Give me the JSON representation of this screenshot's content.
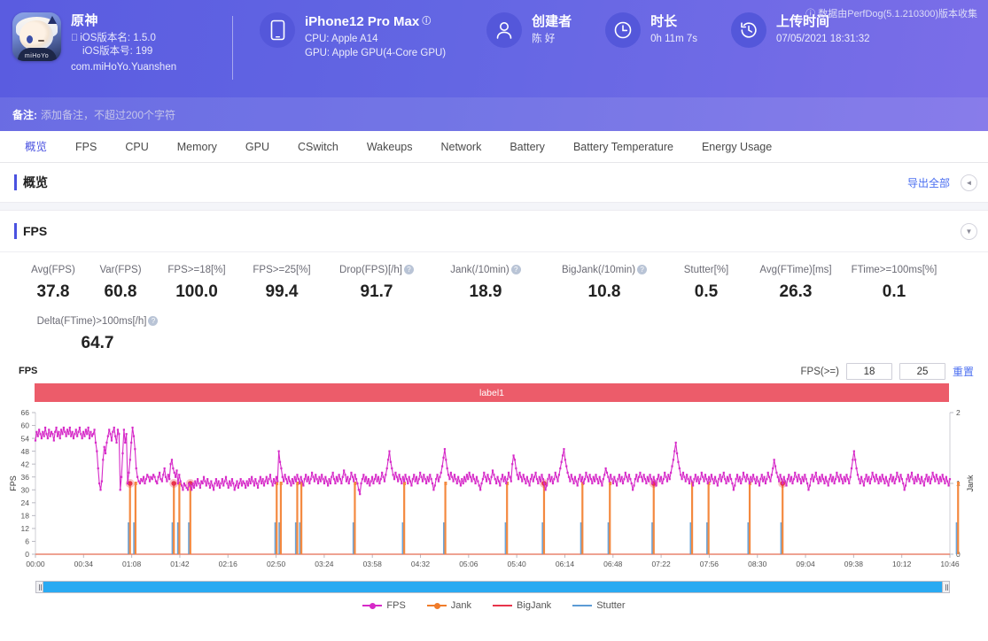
{
  "header": {
    "app": {
      "name": "原神",
      "icon_brand": "miHoYo",
      "version_name_label": "iOS版本名: 1.5.0",
      "version_code_label": "iOS版本号: 199",
      "package": "com.miHoYo.Yuanshen",
      "apple_glyph": ""
    },
    "device": {
      "title": "iPhone12 Pro Max",
      "info_glyph": "i",
      "cpu": "CPU: Apple A14",
      "gpu": "GPU: Apple GPU(4-Core GPU)"
    },
    "creator": {
      "title": "创建者",
      "value": "陈 好"
    },
    "duration": {
      "title": "时长",
      "value": "0h 11m 7s"
    },
    "upload": {
      "title": "上传时间",
      "value": "07/05/2021 18:31:32"
    },
    "collect_note": "数据由PerfDog(5.1.210300)版本收集",
    "note": {
      "label": "备注:",
      "placeholder": "添加备注，不超过200个字符"
    }
  },
  "tabs": [
    {
      "label": "概览",
      "active": true
    },
    {
      "label": "FPS",
      "active": false
    },
    {
      "label": "CPU",
      "active": false
    },
    {
      "label": "Memory",
      "active": false
    },
    {
      "label": "GPU",
      "active": false
    },
    {
      "label": "CSwitch",
      "active": false
    },
    {
      "label": "Wakeups",
      "active": false
    },
    {
      "label": "Network",
      "active": false
    },
    {
      "label": "Battery",
      "active": false
    },
    {
      "label": "Battery Temperature",
      "active": false
    },
    {
      "label": "Energy Usage",
      "active": false
    }
  ],
  "overview_section": {
    "title": "概览",
    "export_all": "导出全部",
    "collapse_icon": "◄"
  },
  "fps_section": {
    "title": "FPS",
    "collapse_icon": "▼"
  },
  "metrics": [
    {
      "label": "Avg(FPS)",
      "value": "37.8",
      "help": false
    },
    {
      "label": "Var(FPS)",
      "value": "60.8",
      "help": false
    },
    {
      "label": "FPS>=18[%]",
      "value": "100.0",
      "help": false
    },
    {
      "label": "FPS>=25[%]",
      "value": "99.4",
      "help": false
    },
    {
      "label": "Drop(FPS)[/h]",
      "value": "91.7",
      "help": true
    },
    {
      "label": "Jank(/10min)",
      "value": "18.9",
      "help": true
    },
    {
      "label": "BigJank(/10min)",
      "value": "10.8",
      "help": true
    },
    {
      "label": "Stutter[%]",
      "value": "0.5",
      "help": false
    },
    {
      "label": "Avg(FTime)[ms]",
      "value": "26.3",
      "help": false
    },
    {
      "label": "FTime>=100ms[%]",
      "value": "0.1",
      "help": false
    }
  ],
  "metrics_row2": [
    {
      "label": "Delta(FTime)>100ms[/h]",
      "value": "64.7",
      "help": true
    }
  ],
  "chart_controls": {
    "corner_label": "FPS",
    "threshold_label": "FPS(>=)",
    "threshold_low": "18",
    "threshold_high": "25",
    "reset_label": "重置"
  },
  "chart_data": {
    "type": "line",
    "title": "FPS",
    "band_label": "label1",
    "band_color": "#ec5c6a",
    "xlabel": "",
    "ylabel": "FPS",
    "y2label": "Jank",
    "ylim": [
      0,
      66
    ],
    "y2lim": [
      0,
      2
    ],
    "yticks": [
      0,
      6,
      12,
      18,
      24,
      30,
      36,
      42,
      48,
      54,
      60,
      66
    ],
    "y2ticks": [
      0,
      1,
      2
    ],
    "xticks": [
      "00:00",
      "00:34",
      "01:08",
      "01:42",
      "02:16",
      "02:50",
      "03:24",
      "03:58",
      "04:32",
      "05:06",
      "05:40",
      "06:14",
      "06:48",
      "07:22",
      "07:56",
      "08:30",
      "09:04",
      "09:38",
      "10:12",
      "10:46"
    ],
    "grid": false,
    "legend_position": "bottom",
    "legend": [
      {
        "name": "FPS",
        "color": "#d62ac8",
        "marker": "dot"
      },
      {
        "name": "Jank",
        "color": "#f07c2a",
        "marker": "dot"
      },
      {
        "name": "BigJank",
        "color": "#e8344a",
        "marker": "line"
      },
      {
        "name": "Stutter",
        "color": "#5b9bd5",
        "marker": "line"
      }
    ],
    "series": [
      {
        "name": "FPS",
        "color": "#d62ac8",
        "axis": "left",
        "values": [
          53,
          57,
          55,
          58,
          56,
          54,
          57,
          55,
          59,
          56,
          54,
          58,
          55,
          57,
          56,
          53,
          57,
          59,
          55,
          57,
          54,
          58,
          56,
          59,
          57,
          55,
          58,
          56,
          59,
          55,
          57,
          54,
          56,
          58,
          55,
          57,
          59,
          56,
          54,
          57,
          55,
          58,
          56,
          59,
          54,
          57,
          55,
          56,
          58,
          52,
          48,
          40,
          33,
          30,
          34,
          44,
          50,
          47,
          52,
          55,
          58,
          56,
          53,
          57,
          59,
          55,
          52,
          58,
          56,
          30,
          36,
          47,
          58,
          52,
          56,
          33,
          38,
          44,
          52,
          59,
          55,
          49,
          40,
          36,
          34,
          33,
          35,
          34,
          36,
          33,
          35,
          37,
          36,
          34,
          36,
          35,
          37,
          36,
          34,
          33,
          36,
          38,
          35,
          34,
          37,
          40,
          36,
          34,
          37,
          35,
          42,
          44,
          40,
          38,
          36,
          39,
          33,
          37,
          34,
          32,
          30,
          33,
          32,
          31,
          30,
          33,
          32,
          30,
          33,
          31,
          34,
          32,
          35,
          33,
          31,
          34,
          33,
          36,
          34,
          32,
          35,
          33,
          31,
          34,
          32,
          30,
          33,
          35,
          32,
          34,
          31,
          33,
          35,
          32,
          34,
          36,
          33,
          31,
          34,
          32,
          35,
          33,
          30,
          32,
          34,
          31,
          33,
          35,
          32,
          34,
          33,
          31,
          34,
          32,
          35,
          33,
          36,
          34,
          32,
          35,
          33,
          31,
          34,
          36,
          33,
          35,
          32,
          34,
          36,
          33,
          35,
          37,
          34,
          32,
          35,
          33,
          36,
          34,
          48,
          43,
          40,
          36,
          34,
          37,
          35,
          33,
          36,
          34,
          32,
          35,
          33,
          36,
          34,
          37,
          35,
          33,
          36,
          34,
          32,
          35,
          37,
          34,
          36,
          33,
          35,
          38,
          36,
          34,
          37,
          35,
          33,
          36,
          34,
          37,
          35,
          33,
          36,
          34,
          32,
          35,
          33,
          36,
          38,
          35,
          33,
          36,
          34,
          37,
          35,
          33,
          36,
          39,
          37,
          34,
          36,
          33,
          35,
          38,
          36,
          34,
          37,
          35,
          33,
          30,
          28,
          33,
          35,
          37,
          34,
          36,
          33,
          35,
          32,
          34,
          36,
          33,
          35,
          37,
          34,
          36,
          33,
          35,
          38,
          36,
          34,
          37,
          40,
          44,
          48,
          43,
          40,
          37,
          35,
          38,
          36,
          34,
          37,
          35,
          33,
          36,
          34,
          37,
          35,
          33,
          36,
          34,
          32,
          35,
          37,
          34,
          36,
          33,
          35,
          38,
          36,
          34,
          37,
          35,
          33,
          36,
          34,
          37,
          35,
          33,
          30,
          32,
          35,
          37,
          34,
          36,
          38,
          41,
          45,
          49,
          44,
          40,
          37,
          35,
          38,
          36,
          34,
          37,
          35,
          33,
          36,
          34,
          32,
          35,
          33,
          36,
          34,
          37,
          35,
          38,
          36,
          34,
          37,
          35,
          33,
          36,
          34,
          32,
          30,
          33,
          35,
          38,
          36,
          34,
          37,
          35,
          33,
          36,
          39,
          37,
          35,
          33,
          36,
          34,
          32,
          35,
          37,
          34,
          36,
          33,
          35,
          38,
          36,
          34,
          42,
          46,
          44,
          40,
          37,
          35,
          38,
          36,
          34,
          37,
          35,
          33,
          36,
          34,
          32,
          35,
          37,
          34,
          36,
          38,
          35,
          33,
          36,
          34,
          37,
          35,
          33,
          30,
          32,
          35,
          37,
          34,
          36,
          33,
          35,
          38,
          36,
          34,
          37,
          40,
          43,
          46,
          49,
          44,
          41,
          38,
          36,
          34,
          37,
          35,
          33,
          36,
          34,
          32,
          35,
          37,
          34,
          36,
          33,
          35,
          38,
          36,
          34,
          37,
          35,
          33,
          36,
          34,
          37,
          35,
          33,
          36,
          34,
          32,
          35,
          37,
          40,
          38,
          36,
          34,
          37,
          35,
          33,
          36,
          34,
          32,
          35,
          37,
          34,
          36,
          33,
          35,
          38,
          36,
          34,
          37,
          35,
          33,
          30,
          32,
          35,
          37,
          34,
          36,
          38,
          36,
          34,
          37,
          35,
          33,
          36,
          34,
          37,
          35,
          33,
          36,
          34,
          32,
          35,
          37,
          34,
          36,
          33,
          35,
          38,
          36,
          34,
          37,
          35,
          38,
          41,
          44,
          48,
          52,
          47,
          43,
          40,
          37,
          35,
          38,
          36,
          34,
          37,
          35,
          33,
          36,
          34,
          32,
          35,
          37,
          34,
          36,
          33,
          35,
          38,
          36,
          34,
          37,
          35,
          33,
          36,
          34,
          37,
          35,
          33,
          36,
          34,
          32,
          35,
          37,
          34,
          36,
          38,
          35,
          33,
          36,
          34,
          37,
          35,
          33,
          30,
          32,
          35,
          37,
          34,
          36,
          33,
          35,
          38,
          36,
          34,
          37,
          35,
          33,
          36,
          34,
          37,
          35,
          33,
          36,
          34,
          32,
          35,
          37,
          34,
          36,
          33,
          35,
          38,
          36,
          34,
          37,
          40,
          44,
          41,
          38,
          36,
          34,
          37,
          35,
          33,
          36,
          34,
          32,
          35,
          37,
          34,
          36,
          33,
          35,
          38,
          36,
          34,
          37,
          35,
          33,
          36,
          34,
          37,
          35,
          33,
          30,
          32,
          35,
          37,
          34,
          36,
          38,
          35,
          33,
          36,
          34,
          37,
          35,
          33,
          36,
          34,
          32,
          35,
          37,
          34,
          36,
          33,
          35,
          38,
          36,
          34,
          37,
          35,
          33,
          36,
          34,
          37,
          35,
          33,
          36,
          40,
          44,
          48,
          44,
          40,
          37,
          35,
          33,
          36,
          34,
          32,
          35,
          37,
          34,
          36,
          33,
          35,
          38,
          36,
          34,
          37,
          35,
          33,
          36,
          34,
          37,
          35,
          33,
          36,
          34,
          32,
          35,
          37,
          34,
          36,
          33,
          35,
          38,
          36,
          34,
          37,
          35,
          33,
          30,
          32,
          35,
          37,
          34,
          36,
          38,
          35,
          33,
          36,
          34,
          37,
          35,
          33,
          36,
          34,
          32,
          35,
          37,
          34,
          36,
          33,
          35,
          38,
          36,
          34,
          37,
          35,
          33,
          36,
          34,
          37,
          35,
          33,
          36,
          34,
          32,
          35
        ]
      },
      {
        "name": "Jank",
        "color": "#f07c2a",
        "axis": "right",
        "spikes_at_seconds": [
          68,
          72,
          100,
          104,
          112,
          175,
          178,
          190,
          193,
          232,
          268,
          298,
          343,
          370,
          398,
          418,
          450,
          478,
          490,
          520,
          544,
          672
        ],
        "spike_value": 1
      },
      {
        "name": "BigJank",
        "color": "#e8344a",
        "axis": "right",
        "spikes_at_seconds": [
          68,
          100,
          112,
          370,
          450,
          544
        ],
        "spike_value": 1
      },
      {
        "name": "Stutter",
        "color": "#5b9bd5",
        "axis": "right",
        "spikes_at_seconds": [
          68,
          72,
          100,
          104,
          112,
          175,
          178,
          190,
          193,
          232,
          268,
          298,
          343,
          370,
          398,
          418,
          450,
          478,
          490,
          520,
          544,
          672
        ],
        "spike_value": 0.45
      }
    ]
  }
}
